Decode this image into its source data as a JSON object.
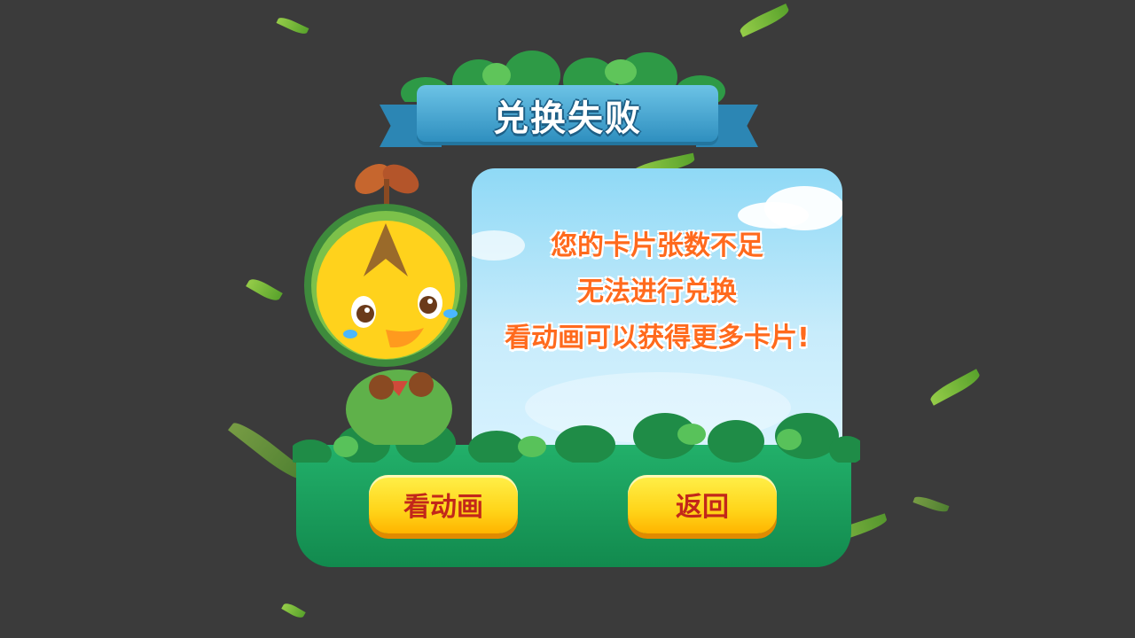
{
  "dialog": {
    "title": "兑换失败",
    "message_lines": [
      "您的卡片张数不足",
      "无法进行兑换",
      "看动画可以获得更多卡片!"
    ]
  },
  "buttons": {
    "watch_label": "看动画",
    "back_label": "返回"
  },
  "colors": {
    "background": "#3b3b3b",
    "banner": "#2f8fbf",
    "message_text": "#ff6a1d",
    "base_green": "#128a4e",
    "button_yellow": "#ffd51a",
    "button_text": "#c2271a"
  },
  "icons": {
    "mascot": "crying-yellow-chick-mascot",
    "decorations": "falling-leaf-icon"
  }
}
